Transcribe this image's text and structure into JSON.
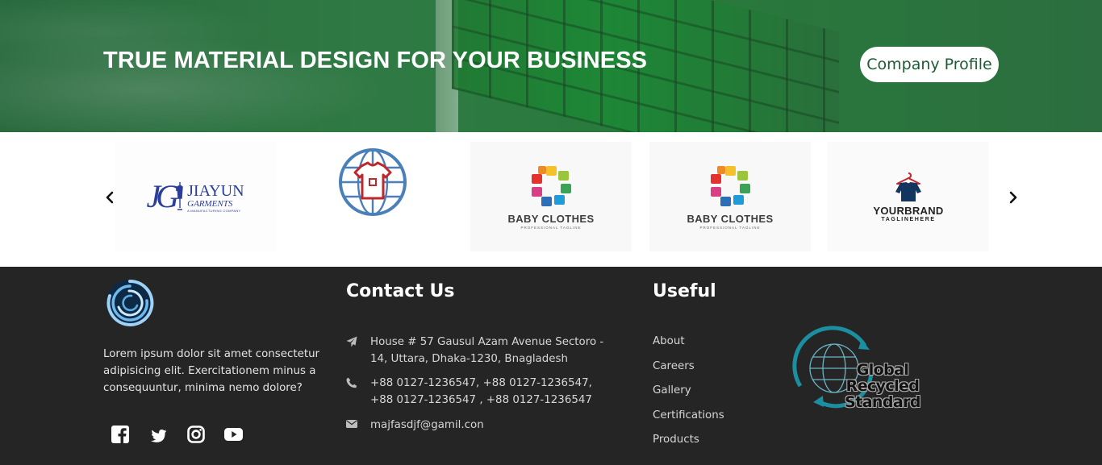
{
  "hero": {
    "title": "TRUE MATERIAL DESIGN FOR YOUR BUSINESS",
    "button_label": "Company Profile",
    "brand_color": "#2b7a44"
  },
  "carousel": {
    "prev_icon": "chevron-left-icon",
    "next_icon": "chevron-right-icon",
    "logos": [
      {
        "name": "JIAYUN",
        "subtitle": "GARMENTS",
        "tagline": "A MANUFACTURING COMPANY",
        "mark": "JG"
      },
      {
        "icon": "globe-tshirt-icon"
      },
      {
        "name": "BABY CLOTHES",
        "tagline": "PROFESSIONAL TAGLINE"
      },
      {
        "name": "BABY CLOTHES",
        "tagline": "PROFESSIONAL TAGLINE"
      },
      {
        "name": "YOURBRAND",
        "tagline": "TAGLINEHERE"
      }
    ]
  },
  "footer": {
    "about_text": "Lorem ipsum dolor sit amet consectetur adipisicing elit. Exercitationem minus a consequuntur, minima nemo dolore?",
    "socials": [
      "facebook-icon",
      "twitter-icon",
      "instagram-icon",
      "youtube-icon"
    ],
    "contact": {
      "title": "Contact Us",
      "address": "House # 57 Gausul Azam Avenue Sectoro - 14, Uttara, Dhaka-1230, Bnagladesh",
      "phone": "+88 0127-1236547, +88 0127-1236547, +88 0127-1236547 , +88 0127-1236547",
      "email": "majfasdjf@gamil.con"
    },
    "useful": {
      "title": "Useful",
      "links": [
        "About",
        "Careers",
        "Gallery",
        "Certifications",
        "Products"
      ]
    },
    "certification": {
      "line1": "Global Recycled",
      "line2": "Standard"
    }
  }
}
